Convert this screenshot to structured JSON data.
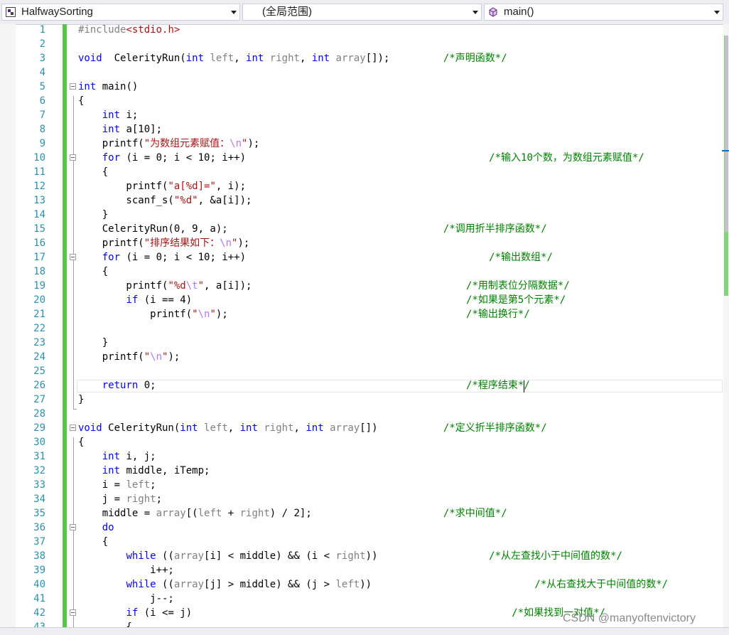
{
  "toolbar": {
    "project": "HalfwaySorting",
    "scope": "(全局范围)",
    "member": "main()"
  },
  "code_lines": [
    {
      "n": "1",
      "parts": [
        [
          "pp",
          "#include"
        ],
        [
          "str",
          "<stdio.h>"
        ]
      ]
    },
    {
      "n": "2",
      "parts": []
    },
    {
      "n": "3",
      "parts": [
        [
          "kw",
          "void"
        ],
        [
          "",
          "  CelerityRun("
        ],
        [
          "kw",
          "int"
        ],
        [
          "",
          " "
        ],
        [
          "par",
          "left"
        ],
        [
          "",
          ", "
        ],
        [
          "kw",
          "int"
        ],
        [
          "",
          " "
        ],
        [
          "par",
          "right"
        ],
        [
          "",
          ", "
        ],
        [
          "kw",
          "int"
        ],
        [
          "",
          " "
        ],
        [
          "par",
          "array"
        ],
        [
          "",
          "[]);"
        ]
      ],
      "comment": "/*声明函数*/",
      "cc": 64
    },
    {
      "n": "4",
      "parts": []
    },
    {
      "n": "5",
      "parts": [
        [
          "kw",
          "int"
        ],
        [
          "",
          " main()"
        ]
      ],
      "fold": true
    },
    {
      "n": "6",
      "parts": [
        [
          "",
          "{"
        ]
      ]
    },
    {
      "n": "7",
      "parts": [
        [
          "",
          "    "
        ],
        [
          "kw",
          "int"
        ],
        [
          "",
          " i;"
        ]
      ]
    },
    {
      "n": "8",
      "parts": [
        [
          "",
          "    "
        ],
        [
          "kw",
          "int"
        ],
        [
          "",
          " a[10];"
        ]
      ]
    },
    {
      "n": "9",
      "parts": [
        [
          "",
          "    printf("
        ],
        [
          "str",
          "\"为数组元素赋值："
        ],
        [
          "esc",
          "\\n"
        ],
        [
          "str",
          "\""
        ],
        [
          "",
          ");"
        ]
      ]
    },
    {
      "n": "10",
      "parts": [
        [
          "",
          "    "
        ],
        [
          "kw",
          "for"
        ],
        [
          "",
          " (i = 0; i < 10; i++)"
        ]
      ],
      "comment": "/*输入10个数，为数组元素赋值*/",
      "cc": 72,
      "fold": true
    },
    {
      "n": "11",
      "parts": [
        [
          "",
          "    {"
        ]
      ]
    },
    {
      "n": "12",
      "parts": [
        [
          "",
          "        printf("
        ],
        [
          "str",
          "\"a[%d]=\""
        ],
        [
          "",
          ", i);"
        ]
      ]
    },
    {
      "n": "13",
      "parts": [
        [
          "",
          "        scanf_s("
        ],
        [
          "str",
          "\"%d\""
        ],
        [
          "",
          ", &a[i]);"
        ]
      ]
    },
    {
      "n": "14",
      "parts": [
        [
          "",
          "    }"
        ]
      ]
    },
    {
      "n": "15",
      "parts": [
        [
          "",
          "    CelerityRun(0, 9, a);"
        ]
      ],
      "comment": "/*调用折半排序函数*/",
      "cc": 64
    },
    {
      "n": "16",
      "parts": [
        [
          "",
          "    printf("
        ],
        [
          "str",
          "\"排序结果如下："
        ],
        [
          "esc",
          "\\n"
        ],
        [
          "str",
          "\""
        ],
        [
          "",
          ");"
        ]
      ]
    },
    {
      "n": "17",
      "parts": [
        [
          "",
          "    "
        ],
        [
          "kw",
          "for"
        ],
        [
          "",
          " (i = 0; i < 10; i++)"
        ]
      ],
      "comment": "/*输出数组*/",
      "cc": 72,
      "fold": true
    },
    {
      "n": "18",
      "parts": [
        [
          "",
          "    {"
        ]
      ]
    },
    {
      "n": "19",
      "parts": [
        [
          "",
          "        printf("
        ],
        [
          "str",
          "\"%d"
        ],
        [
          "esc",
          "\\t"
        ],
        [
          "str",
          "\""
        ],
        [
          "",
          ", a[i]);"
        ]
      ],
      "comment": "/*用制表位分隔数据*/",
      "cc": 68
    },
    {
      "n": "20",
      "parts": [
        [
          "",
          "        "
        ],
        [
          "kw",
          "if"
        ],
        [
          "",
          " (i == 4)"
        ]
      ],
      "comment": "/*如果是第5个元素*/",
      "cc": 68
    },
    {
      "n": "21",
      "parts": [
        [
          "",
          "            printf("
        ],
        [
          "str",
          "\""
        ],
        [
          "esc",
          "\\n"
        ],
        [
          "str",
          "\""
        ],
        [
          "",
          ");"
        ]
      ],
      "comment": "/*输出换行*/",
      "cc": 68
    },
    {
      "n": "22",
      "parts": []
    },
    {
      "n": "23",
      "parts": [
        [
          "",
          "    }"
        ]
      ]
    },
    {
      "n": "24",
      "parts": [
        [
          "",
          "    printf("
        ],
        [
          "str",
          "\""
        ],
        [
          "esc",
          "\\n"
        ],
        [
          "str",
          "\""
        ],
        [
          "",
          ");"
        ]
      ]
    },
    {
      "n": "25",
      "parts": []
    },
    {
      "n": "26",
      "parts": [
        [
          "",
          "    "
        ],
        [
          "kw",
          "return"
        ],
        [
          "",
          " 0;"
        ]
      ],
      "comment": "/*程序结束*/",
      "cc": 68
    },
    {
      "n": "27",
      "parts": [
        [
          "",
          "}"
        ]
      ]
    },
    {
      "n": "28",
      "parts": []
    },
    {
      "n": "29",
      "parts": [
        [
          "kw",
          "void"
        ],
        [
          "",
          " CelerityRun("
        ],
        [
          "kw",
          "int"
        ],
        [
          "",
          " "
        ],
        [
          "par",
          "left"
        ],
        [
          "",
          ", "
        ],
        [
          "kw",
          "int"
        ],
        [
          "",
          " "
        ],
        [
          "par",
          "right"
        ],
        [
          "",
          ", "
        ],
        [
          "kw",
          "int"
        ],
        [
          "",
          " "
        ],
        [
          "par",
          "array"
        ],
        [
          "",
          "[])"
        ]
      ],
      "comment": "/*定义折半排序函数*/",
      "cc": 64,
      "fold": true
    },
    {
      "n": "30",
      "parts": [
        [
          "",
          "{"
        ]
      ]
    },
    {
      "n": "31",
      "parts": [
        [
          "",
          "    "
        ],
        [
          "kw",
          "int"
        ],
        [
          "",
          " i, j;"
        ]
      ]
    },
    {
      "n": "32",
      "parts": [
        [
          "",
          "    "
        ],
        [
          "kw",
          "int"
        ],
        [
          "",
          " middle, iTemp;"
        ]
      ]
    },
    {
      "n": "33",
      "parts": [
        [
          "",
          "    i = "
        ],
        [
          "par",
          "left"
        ],
        [
          "",
          ";"
        ]
      ]
    },
    {
      "n": "34",
      "parts": [
        [
          "",
          "    j = "
        ],
        [
          "par",
          "right"
        ],
        [
          "",
          ";"
        ]
      ]
    },
    {
      "n": "35",
      "parts": [
        [
          "",
          "    middle = "
        ],
        [
          "par",
          "array"
        ],
        [
          "",
          "[("
        ],
        [
          "par",
          "left"
        ],
        [
          "",
          " + "
        ],
        [
          "par",
          "right"
        ],
        [
          "",
          ") / 2];"
        ]
      ],
      "comment": "/*求中间值*/",
      "cc": 64
    },
    {
      "n": "36",
      "parts": [
        [
          "",
          "    "
        ],
        [
          "kw",
          "do"
        ]
      ],
      "fold": true
    },
    {
      "n": "37",
      "parts": [
        [
          "",
          "    {"
        ]
      ]
    },
    {
      "n": "38",
      "parts": [
        [
          "",
          "        "
        ],
        [
          "kw",
          "while"
        ],
        [
          "",
          " (("
        ],
        [
          "par",
          "array"
        ],
        [
          "",
          "[i] < middle) && (i < "
        ],
        [
          "par",
          "right"
        ],
        [
          "",
          "))"
        ]
      ],
      "comment": "/*从左查找小于中间值的数*/",
      "cc": 72
    },
    {
      "n": "39",
      "parts": [
        [
          "",
          "            i++;"
        ]
      ]
    },
    {
      "n": "40",
      "parts": [
        [
          "",
          "        "
        ],
        [
          "kw",
          "while"
        ],
        [
          "",
          " (("
        ],
        [
          "par",
          "array"
        ],
        [
          "",
          "[j] > middle) && (j > "
        ],
        [
          "par",
          "left"
        ],
        [
          "",
          "))"
        ]
      ],
      "comment": "/*从右查找大于中间值的数*/",
      "cc": 80
    },
    {
      "n": "41",
      "parts": [
        [
          "",
          "            j--;"
        ]
      ]
    },
    {
      "n": "42",
      "parts": [
        [
          "",
          "        "
        ],
        [
          "kw",
          "if"
        ],
        [
          "",
          " (i <= j)"
        ]
      ],
      "comment": "/*如果找到一对值*/",
      "cc": 76,
      "fold": true
    },
    {
      "n": "43",
      "parts": [
        [
          "",
          "        {"
        ]
      ]
    }
  ],
  "watermark": "CSDN @manyoftenvictory",
  "colors": {
    "keyword": "#0000ff",
    "string": "#a31515",
    "comment": "#008000",
    "line_number": "#2b91af",
    "change_bar": "#57c44a"
  },
  "icons": {
    "project": "cpp-project-icon",
    "member": "method-cube-icon"
  }
}
